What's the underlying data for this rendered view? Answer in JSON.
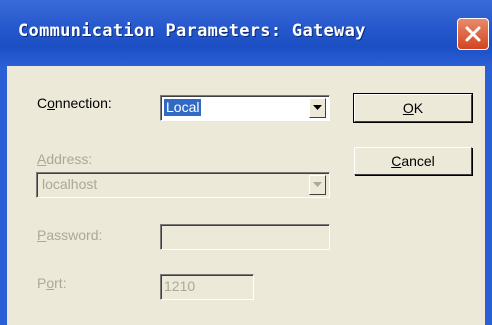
{
  "window": {
    "title": "Communication Parameters: Gateway",
    "close_icon": "close-icon"
  },
  "form": {
    "connection": {
      "label_mnemonic": "o",
      "label_pre": "C",
      "label_post": "nnection:",
      "value": "Local"
    },
    "address": {
      "label_mnemonic": "A",
      "label_post": "ddress:",
      "value": "localhost",
      "enabled": false
    },
    "password": {
      "label_mnemonic": "P",
      "label_post": "assword:",
      "value": "",
      "enabled": false
    },
    "port": {
      "label_pre": "P",
      "label_mnemonic": "o",
      "label_post": "rt:",
      "value": "1210",
      "enabled": false
    }
  },
  "buttons": {
    "ok": {
      "mnemonic": "O",
      "rest": "K"
    },
    "cancel": {
      "mnemonic": "C",
      "rest": "ancel"
    }
  },
  "colors": {
    "title_bar": "#2457cc",
    "selection": "#316ac5",
    "close_button": "#d2451f",
    "disabled_text": "#aca899"
  }
}
